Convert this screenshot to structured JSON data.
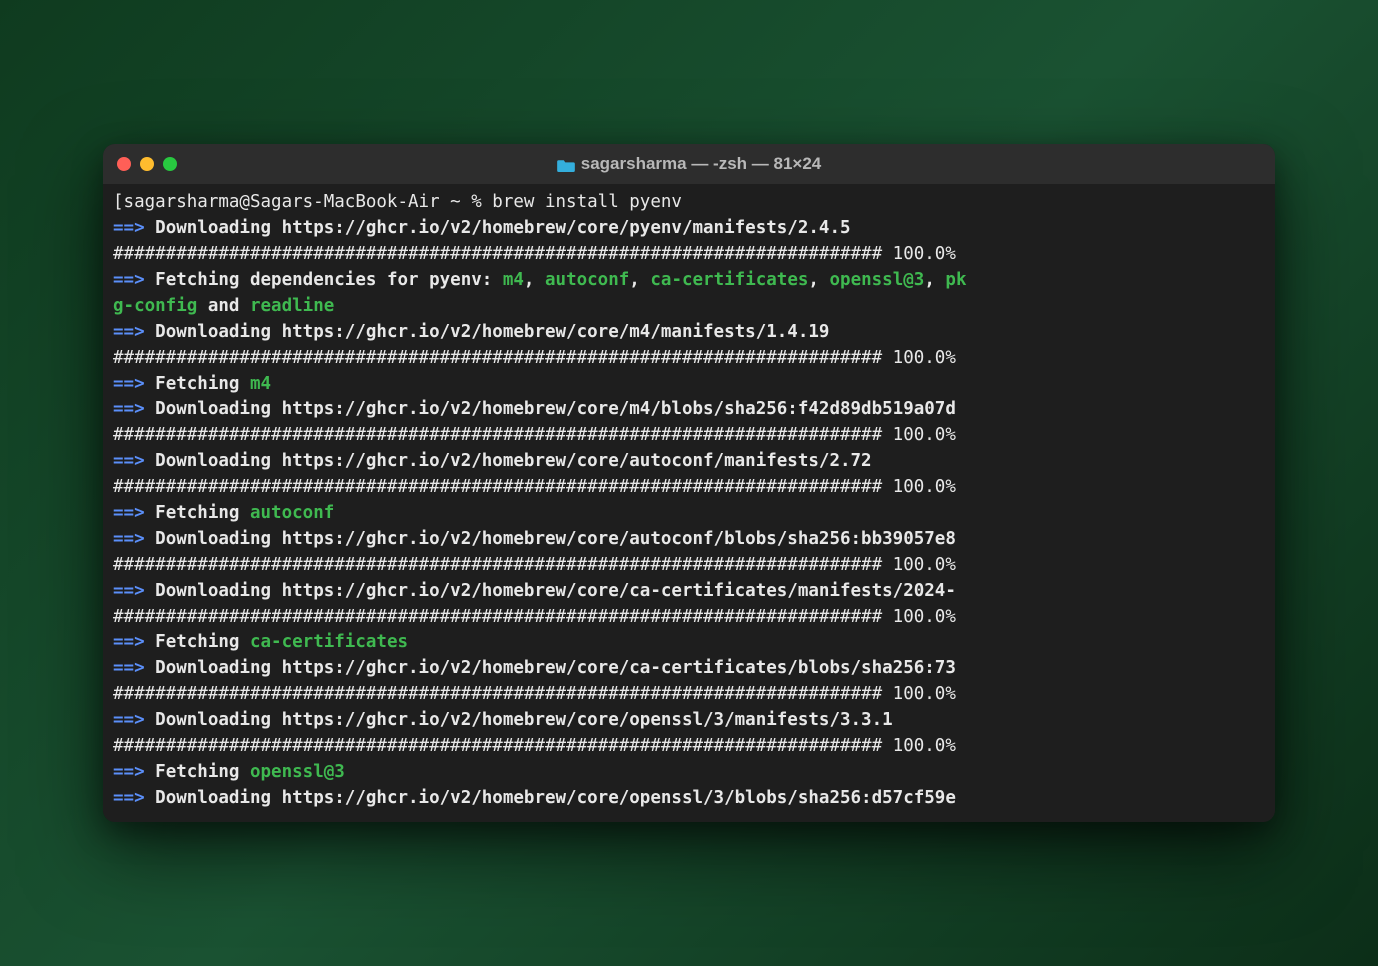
{
  "titlebar": {
    "title": "sagarsharma — -zsh — 81×24"
  },
  "prompt": {
    "text": "[sagarsharma@Sagars-MacBook-Air ~ % ",
    "command": "brew install pyenv"
  },
  "progress_line": "######################################################################### 100.0%",
  "lines": [
    {
      "arrow": "==>",
      "bold": "Downloading https://ghcr.io/v2/homebrew/core/pyenv/manifests/2.4.5"
    },
    {
      "progress": true
    },
    {
      "deps_pre": "Fetching dependencies for pyenv: ",
      "deps_list": [
        "m4",
        "autoconf",
        "ca-certificates",
        "openssl@3",
        "pkg-config",
        "readline"
      ],
      "deps_wrap_after": 4,
      "deps_and": " and "
    },
    {
      "arrow": "==>",
      "bold": "Downloading https://ghcr.io/v2/homebrew/core/m4/manifests/1.4.19"
    },
    {
      "progress": true
    },
    {
      "arrow": "==>",
      "fetch": "m4"
    },
    {
      "arrow": "==>",
      "bold": "Downloading https://ghcr.io/v2/homebrew/core/m4/blobs/sha256:f42d89db519a07d"
    },
    {
      "progress": true
    },
    {
      "arrow": "==>",
      "bold": "Downloading https://ghcr.io/v2/homebrew/core/autoconf/manifests/2.72"
    },
    {
      "progress": true
    },
    {
      "arrow": "==>",
      "fetch": "autoconf"
    },
    {
      "arrow": "==>",
      "bold": "Downloading https://ghcr.io/v2/homebrew/core/autoconf/blobs/sha256:bb39057e8"
    },
    {
      "progress": true
    },
    {
      "arrow": "==>",
      "bold": "Downloading https://ghcr.io/v2/homebrew/core/ca-certificates/manifests/2024-"
    },
    {
      "progress": true
    },
    {
      "arrow": "==>",
      "fetch": "ca-certificates"
    },
    {
      "arrow": "==>",
      "bold": "Downloading https://ghcr.io/v2/homebrew/core/ca-certificates/blobs/sha256:73"
    },
    {
      "progress": true
    },
    {
      "arrow": "==>",
      "bold": "Downloading https://ghcr.io/v2/homebrew/core/openssl/3/manifests/3.3.1"
    },
    {
      "progress": true
    },
    {
      "arrow": "==>",
      "fetch": "openssl@3"
    },
    {
      "arrow": "==>",
      "bold": "Downloading https://ghcr.io/v2/homebrew/core/openssl/3/blobs/sha256:d57cf59e"
    }
  ]
}
